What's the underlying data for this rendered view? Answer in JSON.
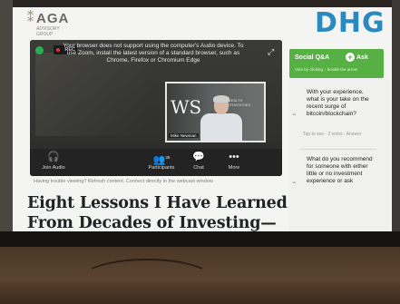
{
  "site": {
    "left_logo": {
      "mark": "⁑",
      "name": "AGA",
      "sub": "ADVISORY GROUP"
    },
    "right_logo": "DHG"
  },
  "player": {
    "message": "Your browser does not support using the computer's Audio device. To use Zoom, install the latest version of a standard browser, such as Chrome, Firefox or Chromium Edge",
    "rec_label": "REC",
    "speaker_name": "Mike Newman",
    "speaker_bg_logo": "WS",
    "speaker_bg_text": "WEALTH STRATEGIES",
    "controls": {
      "join_audio": "Join Audio",
      "participants": "Participants",
      "participants_count": "35",
      "chat": "Chat",
      "more": "More"
    }
  },
  "caption": "Having trouble viewing? Refresh content. Connect directly in the webcast window",
  "article_title": "Eight Lessons I Have Learned From Decades of Investing—",
  "social_qa": {
    "title": "Social Q&A",
    "ask_label": "Ask",
    "vote_note": "Vote by clicking ↑ beside the arrow",
    "questions": [
      {
        "text": "With your experience, what is your take on the recent surge of bitcoin/blockchain?",
        "meta": "Tap to see · 2 votes · Answer"
      },
      {
        "text": "What do you recommend for someone with either little or no investment experience or ask",
        "meta": ""
      }
    ]
  },
  "colors": {
    "accent": "#56b043",
    "dhg_blue": "#2a8ac0"
  }
}
